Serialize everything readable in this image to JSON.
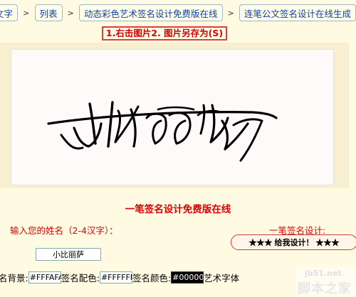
{
  "nav": {
    "crumbs": [
      "文字",
      "列表",
      "动态彩色艺术签名设计免费版在线",
      "连笔公文签名设计在线生成"
    ],
    "separator": ">"
  },
  "hint": "1.右击图片2. 图片另存为(S)",
  "signature": {
    "alt": "小比丽萨"
  },
  "headline": "一笔签名设计免费版在线",
  "form": {
    "name_label": "输入您的姓名（2-4汉字）：",
    "name_value": "小比丽萨",
    "right_label": "一笔签名设计:",
    "submit_label": "★★★ 给我设计！ ★★★"
  },
  "options": {
    "bg_label": "名背景:",
    "bg_value": "#FFFAFA",
    "match_label": "签名配色:",
    "match_value": "#FFFFFF",
    "color_label": "签名颜色:",
    "color_value": "#000000",
    "font_label": "艺术字体"
  },
  "watermark": {
    "url": "jb51.net",
    "text": "脚本之家"
  },
  "colors": {
    "page_bg": "#fffbe3",
    "accent_red": "#e00000",
    "link_blue": "#1040a0",
    "canvas_bg": "#fffafa"
  }
}
